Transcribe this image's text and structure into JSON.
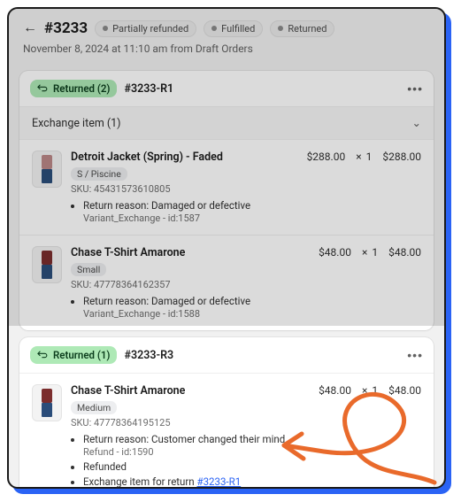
{
  "header": {
    "order_number": "#3233",
    "status_badges": [
      "Partially refunded",
      "Fulfilled",
      "Returned"
    ],
    "meta": "November 8, 2024 at 11:10 am from Draft Orders"
  },
  "cards": [
    {
      "badge_label": "Returned (2)",
      "return_id": "#3233-R1",
      "section_label": "Exchange item (1)",
      "items": [
        {
          "title": "Detroit Jacket (Spring) - Faded",
          "variant": "S / Piscine",
          "sku": "SKU: 45431573610805",
          "price": "$288.00",
          "qty_symbol": "×",
          "qty": "1",
          "total": "$288.00",
          "thumb_color_top": "#b88",
          "thumb_color_bottom": "#2b4d7a",
          "bullets": [
            {
              "text": "Return reason: Damaged or defective",
              "sub": "Variant_Exchange - id:1587"
            }
          ]
        },
        {
          "title": "Chase T-Shirt Amarone",
          "variant": "Small",
          "sku": "SKU: 47778364162357",
          "price": "$48.00",
          "qty_symbol": "×",
          "qty": "1",
          "total": "$48.00",
          "thumb_color_top": "#7b2d2d",
          "thumb_color_bottom": "#2b4d7a",
          "bullets": [
            {
              "text": "Return reason: Damaged or defective",
              "sub": "Variant_Exchange - id:1588"
            }
          ]
        }
      ]
    },
    {
      "badge_label": "Returned (1)",
      "return_id": "#3233-R3",
      "items": [
        {
          "title": "Chase T-Shirt Amarone",
          "variant": "Medium",
          "sku": "SKU: 47778364195125",
          "price": "$48.00",
          "qty_symbol": "×",
          "qty": "1",
          "total": "$48.00",
          "thumb_color_top": "#7b2d2d",
          "thumb_color_bottom": "#2b4d7a",
          "bullets": [
            {
              "text": "Return reason: Customer changed their mind",
              "sub": "Refund - id:1590"
            },
            {
              "text": "Refunded"
            },
            {
              "text_prefix": "Exchange item for return ",
              "link": "#3233-R1"
            }
          ]
        }
      ]
    }
  ]
}
